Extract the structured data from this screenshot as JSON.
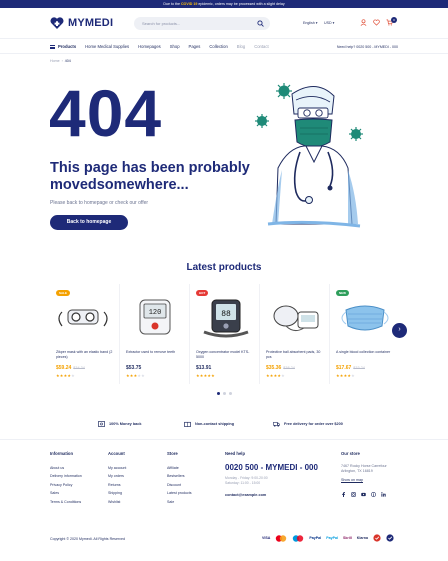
{
  "topbar": {
    "prefix": "Due to the",
    "highlight": "COVID 19",
    "suffix": "epidemic, orders may be processed with a slight delay"
  },
  "header": {
    "logo_text": "MYMEDI",
    "search_placeholder": "Search for products...",
    "language": "English",
    "currency": "USD",
    "cart_count": "0"
  },
  "nav": {
    "categories_label": "Products",
    "items": [
      "Home Medical Supplies",
      "Homepages",
      "Shop",
      "Pages",
      "Collection",
      "Blog",
      "Contact"
    ],
    "help_text": "Need help? 0020 500 - MYMEDI - 000"
  },
  "breadcrumb": {
    "home": "Home",
    "current": "404"
  },
  "error": {
    "code": "404",
    "headline": "This page has been probably movedsomewhere...",
    "subtext": "Please back to homepage or check our offer",
    "button": "Back to homepage"
  },
  "latest": {
    "title": "Latest products",
    "products": [
      {
        "name": "Zikper mask with an elastic band (2 pieces)",
        "price": "$59.24",
        "old_price": "$34.34",
        "badge": "SALE",
        "badge_color": "#f4a100",
        "rating": 4,
        "sale": true,
        "icon": "mask-icon"
      },
      {
        "name": "Extractor used to remove teeth",
        "price": "$53.75",
        "old_price": "",
        "badge": "",
        "badge_color": "",
        "rating": 3,
        "sale": false,
        "icon": "blood-pressure-icon"
      },
      {
        "name": "Oxygen concentrator model KTS-5000",
        "price": "$13.91",
        "old_price": "",
        "badge": "HOT",
        "badge_color": "#e53935",
        "rating": 5,
        "sale": false,
        "icon": "wrist-monitor-icon"
      },
      {
        "name": "Protective ball absorbent pads, 30 pcs",
        "price": "$35.36",
        "old_price": "$38.24",
        "badge": "",
        "badge_color": "",
        "rating": 4,
        "sale": true,
        "icon": "arm-monitor-icon"
      },
      {
        "name": "A single blood collection container",
        "price": "$17.67",
        "old_price": "$33.24",
        "badge": "NEW",
        "badge_color": "#2e9e5b",
        "rating": 4,
        "sale": true,
        "icon": "face-mask-icon"
      }
    ]
  },
  "features": [
    "100% Money back",
    "Non-contact shipping",
    "Free delivery for order over $200"
  ],
  "footer": {
    "information": {
      "title": "Information",
      "links": [
        "About us",
        "Delivery information",
        "Privacy Policy",
        "Sales",
        "Terms & Conditions"
      ]
    },
    "account": {
      "title": "Account",
      "links": [
        "My account",
        "My orders",
        "Returns",
        "Shipping",
        "Wishlist"
      ]
    },
    "store": {
      "title": "Store",
      "links": [
        "Affiliate",
        "Bestsellers",
        "Discount",
        "Latest products",
        "Sale"
      ]
    },
    "help": {
      "title": "Need help",
      "phone": "0020 500 - MYMEDI - 000",
      "hours1": "Monday - Friday: 9:00-20:00",
      "hours2": "Saturday: 11:00 - 15:00",
      "email": "contact@example.com"
    },
    "our_store": {
      "title": "Our store",
      "address1": "7467 Rocky Horse Carrefour",
      "address2": "Arlington, TX 16819",
      "map": "Show on map"
    },
    "copyright": "Copyright © 2020 Mymedi. All Rights Reserved",
    "payments": [
      "VISA",
      "MC",
      "MC",
      "PayPal",
      "PayPal",
      "Skrill",
      "Klarna",
      "",
      ""
    ]
  },
  "colors": {
    "primary": "#1e2a78",
    "accent": "#f4a100",
    "hot": "#e53935",
    "new": "#2e9e5b"
  }
}
